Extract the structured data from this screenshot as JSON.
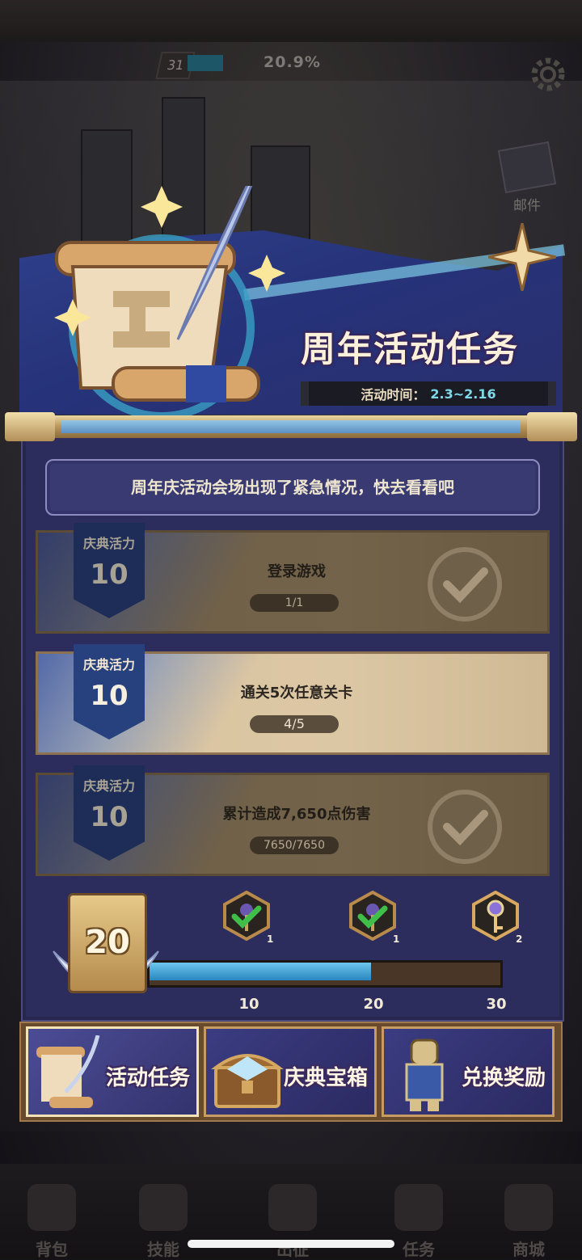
{
  "hud": {
    "level": "31",
    "progress_percent": "20.9%",
    "mail_label": "邮件"
  },
  "event": {
    "title": "周年活动任务",
    "time_label": "活动时间：",
    "time_value": "2.3~2.16",
    "notice": "周年庆活动会场出现了紧急情况，快去看看吧"
  },
  "tasks": [
    {
      "reward_label": "庆典活力",
      "reward_points": "10",
      "title": "登录游戏",
      "progress": "1/1",
      "completed": true
    },
    {
      "reward_label": "庆典活力",
      "reward_points": "10",
      "title": "通关5次任意关卡",
      "progress": "4/5",
      "completed": false
    },
    {
      "reward_label": "庆典活力",
      "reward_points": "10",
      "title": "累计造成7,650点伤害",
      "progress": "7650/7650",
      "completed": true
    }
  ],
  "vitality": {
    "current": "20",
    "milestones": [
      {
        "label": "10",
        "reward_count": "1",
        "claimed": true,
        "icon": "key-icon"
      },
      {
        "label": "20",
        "reward_count": "1",
        "claimed": true,
        "icon": "key-icon"
      },
      {
        "label": "30",
        "reward_count": "2",
        "claimed": false,
        "icon": "key-icon"
      }
    ],
    "fill_fraction": 0.64
  },
  "tabs": [
    {
      "label": "活动任务",
      "active": true,
      "icon": "scroll-icon"
    },
    {
      "label": "庆典宝箱",
      "active": false,
      "icon": "treasure-chest-icon"
    },
    {
      "label": "兑换奖励",
      "active": false,
      "icon": "knight-icon"
    }
  ],
  "bottom_nav": [
    {
      "label": "背包",
      "icon": "bag-icon"
    },
    {
      "label": "技能",
      "icon": "skill-icon"
    },
    {
      "label": "出征",
      "icon": "battle-icon"
    },
    {
      "label": "任务",
      "icon": "quest-icon"
    },
    {
      "label": "商城",
      "icon": "shop-icon"
    }
  ],
  "colors": {
    "panel": "#2c2d5c",
    "accent_blue": "#7fd9e8",
    "gold": "#c79c62",
    "check_green": "#3fbf4a"
  }
}
